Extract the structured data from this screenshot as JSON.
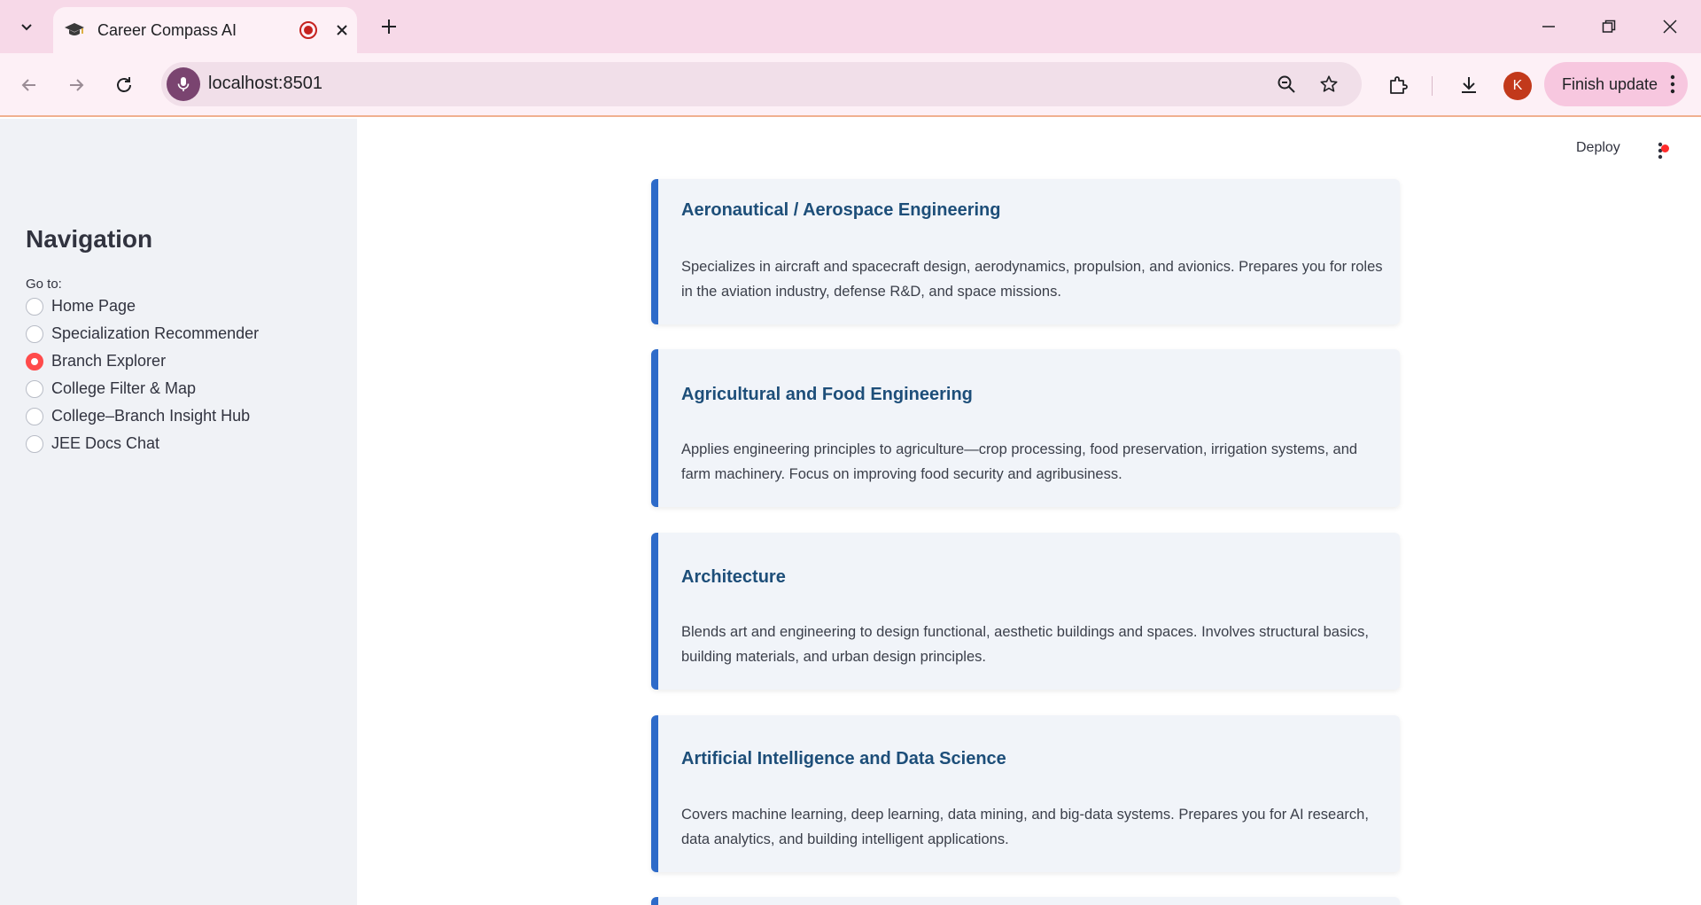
{
  "browser": {
    "tab_title": "Career Compass AI",
    "url": "localhost:8501",
    "profile_initial": "K",
    "finish_update_label": "Finish update"
  },
  "app": {
    "deploy_label": "Deploy",
    "sidebar": {
      "title": "Navigation",
      "goto_label": "Go to:",
      "items": [
        {
          "label": "Home Page",
          "selected": false
        },
        {
          "label": "Specialization Recommender",
          "selected": false
        },
        {
          "label": "Branch Explorer",
          "selected": true
        },
        {
          "label": "College Filter & Map",
          "selected": false
        },
        {
          "label": "College–Branch Insight Hub",
          "selected": false
        },
        {
          "label": "JEE Docs Chat",
          "selected": false
        }
      ]
    },
    "branches": [
      {
        "title": "Aeronautical / Aerospace Engineering",
        "description": "Specializes in aircraft and spacecraft design, aerodynamics, propulsion, and avionics. Prepares you for roles in the aviation industry, defense R&D, and space missions."
      },
      {
        "title": "Agricultural and Food Engineering",
        "description": "Applies engineering principles to agriculture—crop processing, food preservation, irrigation systems, and farm machinery. Focus on improving food security and agribusiness."
      },
      {
        "title": "Architecture",
        "description": "Blends art and engineering to design functional, aesthetic buildings and spaces. Involves structural basics, building materials, and urban design principles."
      },
      {
        "title": "Artificial Intelligence and Data Science",
        "description": "Covers machine learning, deep learning, data mining, and big-data systems. Prepares you for AI research, data analytics, and building intelligent applications."
      }
    ]
  },
  "colors": {
    "accent_red": "#ff4b4b",
    "card_border": "#2e6bc9",
    "card_title": "#1d4e79",
    "sidebar_bg": "#f0f2f6",
    "tabbar_bg": "#f7d9e8"
  }
}
